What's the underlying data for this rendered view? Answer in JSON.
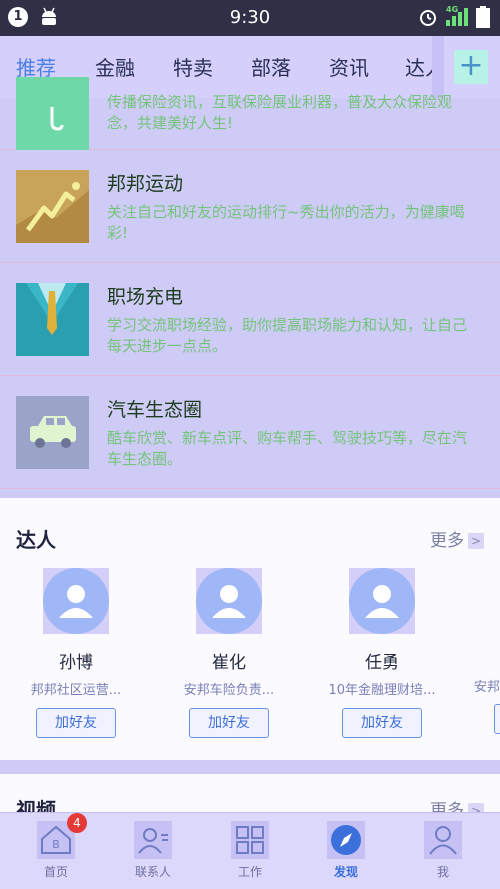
{
  "status_bar": {
    "notification_count": "1",
    "time": "9:30",
    "network": "4G"
  },
  "tabs": [
    {
      "label": "推荐",
      "active": true
    },
    {
      "label": "金融",
      "active": false
    },
    {
      "label": "特卖",
      "active": false
    },
    {
      "label": "部落",
      "active": false
    },
    {
      "label": "资讯",
      "active": false
    },
    {
      "label": "达人",
      "active": false
    }
  ],
  "tab_add_label": "+",
  "list_items": [
    {
      "title": "",
      "desc": "传播保险资讯，互联保险展业利器，普及大众保险观念，共建美好人生!",
      "icon": "umbrella-icon"
    },
    {
      "title": "邦邦运动",
      "desc": "关注自己和好友的运动排行~秀出你的活力，为健康喝彩!",
      "icon": "running-icon"
    },
    {
      "title": "职场充电",
      "desc": "学习交流职场经验，助你提高职场能力和认知，让自己每天进步一点点。",
      "icon": "suit-tie-icon"
    },
    {
      "title": "汽车生态圈",
      "desc": "酷车欣赏、新车点评、购车帮手、驾驶技巧等，尽在汽车生态圈。",
      "icon": "car-icon"
    }
  ],
  "experts_section": {
    "title": "达人",
    "more": "更多",
    "experts": [
      {
        "name": "孙博",
        "role": "邦邦社区运营...",
        "button": "加好友"
      },
      {
        "name": "崔化",
        "role": "安邦车险负责...",
        "button": "加好友"
      },
      {
        "name": "任勇",
        "role": "10年金融理财培...",
        "button": "加好友"
      },
      {
        "name": "",
        "role": "安邦",
        "button": ""
      }
    ]
  },
  "video_section": {
    "title": "视频",
    "more": "更多"
  },
  "bottom_nav": [
    {
      "label": "首页",
      "icon": "home-icon",
      "badge": "4",
      "active": false
    },
    {
      "label": "联系人",
      "icon": "contacts-icon",
      "badge": "",
      "active": false
    },
    {
      "label": "工作",
      "icon": "grid-icon",
      "badge": "",
      "active": false
    },
    {
      "label": "发现",
      "icon": "compass-icon",
      "badge": "",
      "active": true
    },
    {
      "label": "我",
      "icon": "person-icon",
      "badge": "",
      "active": false
    }
  ],
  "colors": {
    "accent": "#4a7ee8",
    "badge": "#e53935",
    "desc_text": "#73c47a"
  }
}
